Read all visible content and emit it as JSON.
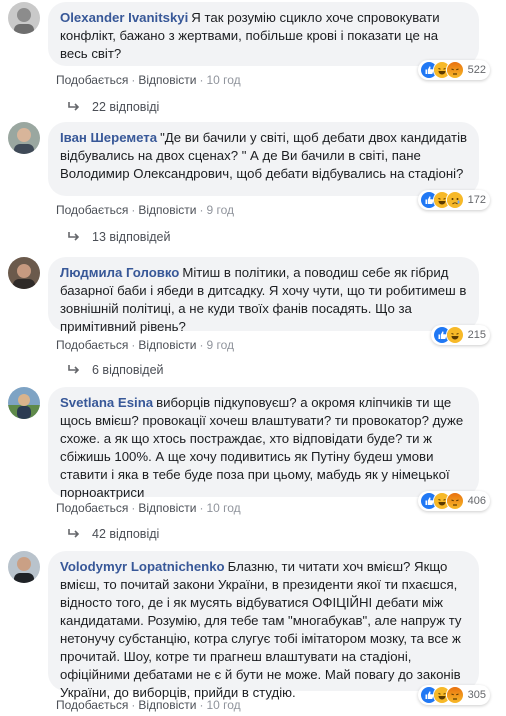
{
  "actions": {
    "like": "Подобається",
    "reply": "Відповісти",
    "separator": "·"
  },
  "colors": {
    "like_blue": "#2078f4",
    "haha_yellow": "#f7b928",
    "angry_orange": "#e9710f",
    "author_link": "#385898"
  },
  "comments": [
    {
      "author": "Olexander Ivanitskyi",
      "text": "Я так розумію сцикло хоче спровокувати конфлікт, бажано з жертвами, побільше крові і показати це на весь світ?",
      "time": "10 год",
      "reactions": {
        "icons": [
          "like-icon",
          "haha-icon",
          "angry-icon"
        ],
        "count": "522"
      },
      "replies": "22 відповіді"
    },
    {
      "author": "Іван Шеремета",
      "text": "\"Де ви бачили у світі, щоб дебати двох кандидатів відбувались на двох сценах? \" А де Ви бачили в світі, пане Володимир Олександрович, щоб дебати відбувались на стадіоні?",
      "time": "9 год",
      "reactions": {
        "icons": [
          "like-icon",
          "haha-icon",
          "sad-icon"
        ],
        "count": "172"
      },
      "replies": "13 відповідей"
    },
    {
      "author": "Людмила Головко",
      "text": "Мітиш в політики, а поводиш себе як гібрид базарної баби і ябеди в дитсадку. Я хочу чути, що ти робитимеш в зовнішній політиці, а не куди твоїх фанів посадять. Що за примітивний рівень?",
      "time": "9 год",
      "reactions": {
        "icons": [
          "like-icon",
          "haha-icon"
        ],
        "count": "215"
      },
      "replies": "6 відповідей"
    },
    {
      "author": "Svetlana Esina",
      "text": "виборців підкуповуєш? а окромя кліпчиків ти ще щось вмієш? провокації хочеш влаштувати? ти провокатор? дуже схоже. а як що хтось постраждає, хто відповідати буде? ти ж сбіжишь 100%. А ще хочу подивитись як Путіну будеш умови ставити і яка в тебе буде поза при цьому, мабудь як у німецької порноактриси",
      "time": "10 год",
      "reactions": {
        "icons": [
          "like-icon",
          "haha-icon",
          "angry-icon"
        ],
        "count": "406"
      },
      "replies": "42 відповіді"
    },
    {
      "author": "Volodymyr Lopatnichenko",
      "text": "Блазню, ти читати хоч вмієш? Якщо вмієш, то почитай закони України, в президенти якої ти пхаєшся, відносто того, де і як мусять відбуватися ОФІЦІЙНІ дебати між кандидатами. Розумію, для тебе там \"многабукав\", але напруж ту нетонучу субстанцію, котра слугує тобі імітатором мозку, та все ж прочитай. Шоу, котре ти прагнеш влаштувати на стадіоні, офіційними дебатами не є й бути не може. Май повагу до законів України, до виборців, прийди в студію.",
      "time": "10 год",
      "reactions": {
        "icons": [
          "like-icon",
          "haha-icon",
          "angry-icon"
        ],
        "count": "305"
      },
      "replies": ""
    }
  ]
}
